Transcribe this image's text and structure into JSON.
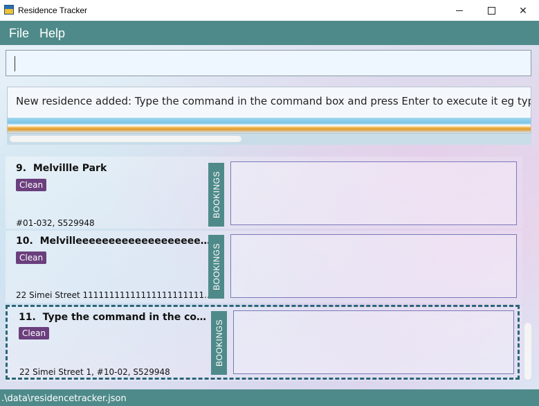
{
  "window": {
    "title": "Residence Tracker",
    "minimize_glyph": "",
    "maximize_glyph": "",
    "close_glyph": "✕",
    "icon": "app-house-icon"
  },
  "menu": {
    "items": [
      {
        "label": "File"
      },
      {
        "label": "Help"
      }
    ]
  },
  "command_box": {
    "value": ""
  },
  "result_display": {
    "text": "New residence added: Type the command in the command box and press Enter to execute it eg typing"
  },
  "residences": [
    {
      "index": "9.",
      "name": "Melvillle Park",
      "tag": "Clean",
      "address": "#01-032, S529948",
      "bookings_label": "BOOKINGS"
    },
    {
      "index": "10.",
      "name": "Melvilleeeeeeeeeeeeeeeeeeeeeeeee...",
      "tag": "Clean",
      "address": "22 Simei Street 11111111111111111111111...",
      "bookings_label": "BOOKINGS"
    },
    {
      "index": "11.",
      "name": "Type the command in the comm...",
      "tag": "Clean",
      "address": "22 Simei Street 1, #10-02, S529948",
      "bookings_label": "BOOKINGS"
    }
  ],
  "status_bar": {
    "file_path": ".\\data\\residencetracker.json"
  },
  "colors": {
    "accent": "#4f8a8a",
    "tag": "#6b3f7d",
    "selection_border": "#2a6577"
  }
}
